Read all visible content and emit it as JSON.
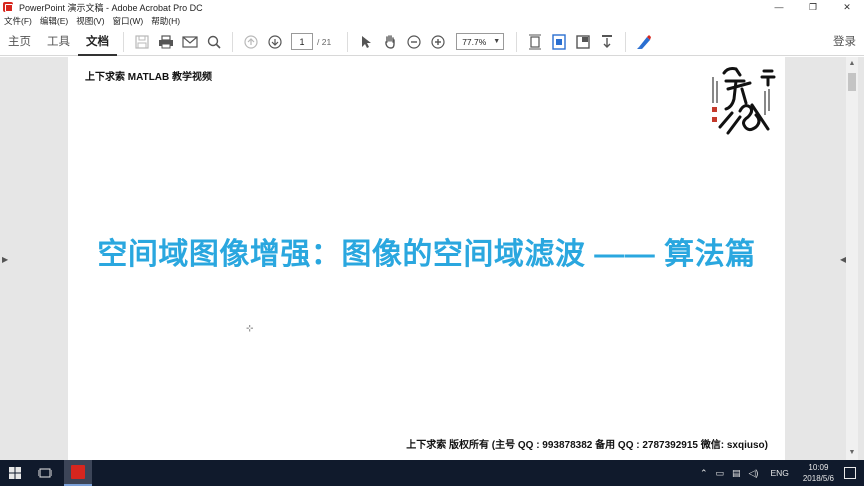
{
  "window": {
    "title": "PowerPoint 演示文稿 - Adobe Acrobat Pro DC",
    "controls": [
      "—",
      "❐",
      "✕"
    ]
  },
  "menu": [
    "文件(F)",
    "编辑(E)",
    "视图(V)",
    "窗口(W)",
    "帮助(H)"
  ],
  "nav_tabs": [
    "主页",
    "工具",
    "文档"
  ],
  "toolbar": {
    "page_current": "1",
    "page_total": "/ 21",
    "zoom": "77.7%",
    "login": "登录"
  },
  "document": {
    "header": "上下求索 MATLAB 教学视频",
    "title": "空间域图像增强：图像的空间域滤波 —— 算法篇",
    "footer": "上下求索  版权所有  (主号 QQ : 993878382   备用 QQ : 2787392915    微信: sxqiuso)"
  },
  "taskbar": {
    "lang": "ENG",
    "time": "10:09",
    "date": "2018/5/6"
  },
  "colors": {
    "title_blue": "#2aa7df",
    "acrobat_red": "#d7261e",
    "taskbar_bg": "#101a2c"
  }
}
